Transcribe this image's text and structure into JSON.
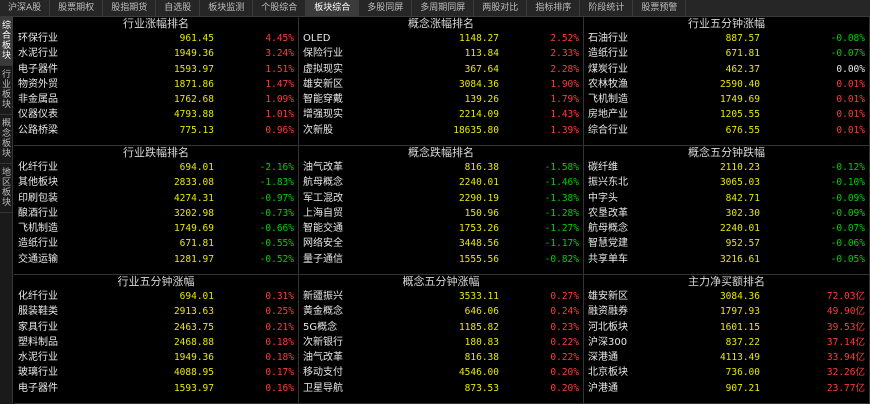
{
  "tabs": [
    "沪深A股",
    "股票期权",
    "股指期货",
    "自选股",
    "板块监测",
    "个股综合",
    "板块综合",
    "多股同屏",
    "多周期同屏",
    "两股对比",
    "指标排序",
    "阶段统计",
    "股票预警"
  ],
  "side_tabs": [
    "综合板块",
    "行业板块",
    "概念板块",
    "地区板块"
  ],
  "panels": [
    {
      "title": "行业涨幅排名",
      "rows": [
        [
          "环保行业",
          "961.45",
          "4.45%",
          "red"
        ],
        [
          "水泥行业",
          "1949.36",
          "3.24%",
          "red"
        ],
        [
          "电子器件",
          "1593.97",
          "1.51%",
          "red"
        ],
        [
          "物资外贸",
          "1871.86",
          "1.47%",
          "red"
        ],
        [
          "非金属品",
          "1762.68",
          "1.09%",
          "red"
        ],
        [
          "仪器仪表",
          "4793.88",
          "1.01%",
          "red"
        ],
        [
          "公路桥梁",
          "775.13",
          "0.96%",
          "red"
        ]
      ]
    },
    {
      "title": "概念涨幅排名",
      "rows": [
        [
          "OLED",
          "1148.27",
          "2.52%",
          "red"
        ],
        [
          "保险行业",
          "113.84",
          "2.33%",
          "red"
        ],
        [
          "虚拟现实",
          "367.64",
          "2.28%",
          "red"
        ],
        [
          "雄安新区",
          "3084.36",
          "1.90%",
          "red"
        ],
        [
          "智能穿戴",
          "139.26",
          "1.79%",
          "red"
        ],
        [
          "增强现实",
          "2214.09",
          "1.43%",
          "red"
        ],
        [
          "次新股",
          "18635.80",
          "1.39%",
          "red"
        ]
      ]
    },
    {
      "title": "行业五分钟涨幅",
      "rows": [
        [
          "石油行业",
          "887.57",
          "-0.08%",
          "green"
        ],
        [
          "造纸行业",
          "671.81",
          "-0.07%",
          "green"
        ],
        [
          "煤炭行业",
          "462.37",
          "0.00%",
          "white"
        ],
        [
          "农林牧渔",
          "2590.40",
          "0.01%",
          "red"
        ],
        [
          "飞机制造",
          "1749.69",
          "0.01%",
          "red"
        ],
        [
          "房地产业",
          "1205.55",
          "0.01%",
          "red"
        ],
        [
          "综合行业",
          "676.55",
          "0.01%",
          "red"
        ]
      ]
    },
    {
      "title": "行业跌幅排名",
      "rows": [
        [
          "化纤行业",
          "694.01",
          "-2.16%",
          "green"
        ],
        [
          "其他板块",
          "2833.08",
          "-1.83%",
          "green"
        ],
        [
          "印刷包装",
          "4274.31",
          "-0.97%",
          "green"
        ],
        [
          "酿酒行业",
          "3202.98",
          "-0.73%",
          "green"
        ],
        [
          "飞机制造",
          "1749.69",
          "-0.66%",
          "green"
        ],
        [
          "造纸行业",
          "671.81",
          "-0.55%",
          "green"
        ],
        [
          "交通运输",
          "1281.97",
          "-0.52%",
          "green"
        ]
      ]
    },
    {
      "title": "概念跌幅排名",
      "rows": [
        [
          "油气改革",
          "816.38",
          "-1.58%",
          "green"
        ],
        [
          "航母概念",
          "2240.01",
          "-1.46%",
          "green"
        ],
        [
          "军工混改",
          "2290.19",
          "-1.38%",
          "green"
        ],
        [
          "上海自贸",
          "150.96",
          "-1.28%",
          "green"
        ],
        [
          "智能交通",
          "1753.26",
          "-1.27%",
          "green"
        ],
        [
          "网络安全",
          "3448.56",
          "-1.17%",
          "green"
        ],
        [
          "量子通信",
          "1555.56",
          "-0.82%",
          "green"
        ]
      ]
    },
    {
      "title": "概念五分钟跌幅",
      "rows": [
        [
          "碳纤维",
          "2110.23",
          "-0.12%",
          "green"
        ],
        [
          "振兴东北",
          "3065.03",
          "-0.10%",
          "green"
        ],
        [
          "中字头",
          "842.71",
          "-0.09%",
          "green"
        ],
        [
          "农垦改革",
          "302.30",
          "-0.09%",
          "green"
        ],
        [
          "航母概念",
          "2240.01",
          "-0.07%",
          "green"
        ],
        [
          "智慧党建",
          "952.57",
          "-0.06%",
          "green"
        ],
        [
          "共享单车",
          "3216.61",
          "-0.05%",
          "green"
        ]
      ]
    },
    {
      "title": "行业五分钟涨幅",
      "rows": [
        [
          "化纤行业",
          "694.01",
          "0.31%",
          "red"
        ],
        [
          "服装鞋类",
          "2913.63",
          "0.25%",
          "red"
        ],
        [
          "家具行业",
          "2463.75",
          "0.21%",
          "red"
        ],
        [
          "塑料制品",
          "2468.88",
          "0.18%",
          "red"
        ],
        [
          "水泥行业",
          "1949.36",
          "0.18%",
          "red"
        ],
        [
          "玻璃行业",
          "4088.95",
          "0.17%",
          "red"
        ],
        [
          "电子器件",
          "1593.97",
          "0.16%",
          "red"
        ]
      ]
    },
    {
      "title": "概念五分钟涨幅",
      "rows": [
        [
          "新疆振兴",
          "3533.11",
          "0.27%",
          "red"
        ],
        [
          "黄金概念",
          "646.06",
          "0.24%",
          "red"
        ],
        [
          "5G概念",
          "1185.82",
          "0.23%",
          "red"
        ],
        [
          "次新银行",
          "180.83",
          "0.22%",
          "red"
        ],
        [
          "油气改革",
          "816.38",
          "0.22%",
          "red"
        ],
        [
          "移动支付",
          "4546.00",
          "0.20%",
          "red"
        ],
        [
          "卫星导航",
          "873.53",
          "0.20%",
          "red"
        ]
      ]
    },
    {
      "title": "主力净买额排名",
      "rows": [
        [
          "雄安新区",
          "3084.36",
          "72.03亿",
          "red"
        ],
        [
          "融资融券",
          "1797.93",
          "49.90亿",
          "red"
        ],
        [
          "河北板块",
          "1601.15",
          "39.53亿",
          "red"
        ],
        [
          "沪深300",
          "837.22",
          "37.14亿",
          "red"
        ],
        [
          "深港通",
          "4113.49",
          "33.94亿",
          "red"
        ],
        [
          "北京板块",
          "736.00",
          "32.26亿",
          "red"
        ],
        [
          "沪港通",
          "907.21",
          "23.77亿",
          "red"
        ]
      ]
    }
  ]
}
